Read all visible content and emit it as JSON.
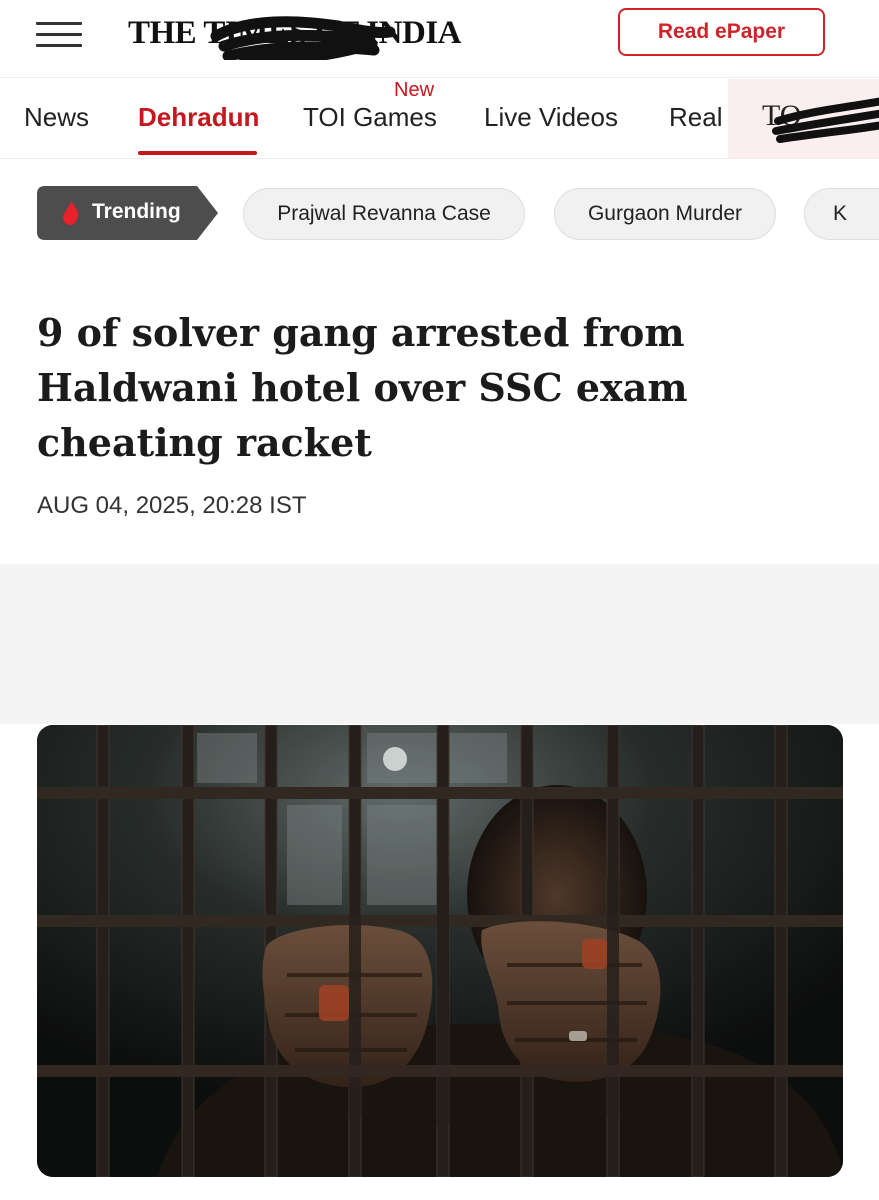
{
  "header": {
    "logo_text": "THE TIMES OF INDIA",
    "menu_icon": "hamburger-menu-icon",
    "epaper_label": "Read ePaper",
    "accent_color": "#d1242a"
  },
  "nav": {
    "items": [
      {
        "label": "News"
      },
      {
        "label": "Dehradun"
      },
      {
        "label": "TOI Games"
      },
      {
        "label": "Live Videos"
      },
      {
        "label": "Real"
      },
      {
        "label": "TO"
      }
    ],
    "active": "Dehradun",
    "new_badge": "New"
  },
  "trending": {
    "label": "Trending",
    "icon": "fire-icon",
    "chips": [
      {
        "label": "Prajwal Revanna Case"
      },
      {
        "label": "Gurgaon Murder"
      },
      {
        "label": "K"
      }
    ]
  },
  "article": {
    "headline": "9 of solver gang arrested from Haldwani hotel over SSC exam cheating racket",
    "timestamp": "AUG 04, 2025, 20:28 IST",
    "image": "hands-gripping-jail-bars-photo"
  }
}
